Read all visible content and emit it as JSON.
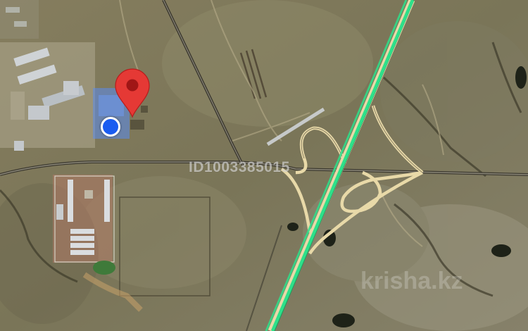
{
  "map": {
    "watermark_id": "ID1003385015",
    "watermark_brand": "krisha.kz",
    "colors": {
      "terrain": "#7a7558",
      "terrain_light": "#908a6c",
      "highway_highlight": "#2ee08a",
      "ramp": "#e8d9a8",
      "road": "#444038",
      "pin": "#e53935",
      "location_dot": "#1a5cf0",
      "location_area": "#5a8cf0"
    },
    "icons": {
      "pin": "map-marker-icon",
      "location": "current-location-dot"
    }
  }
}
